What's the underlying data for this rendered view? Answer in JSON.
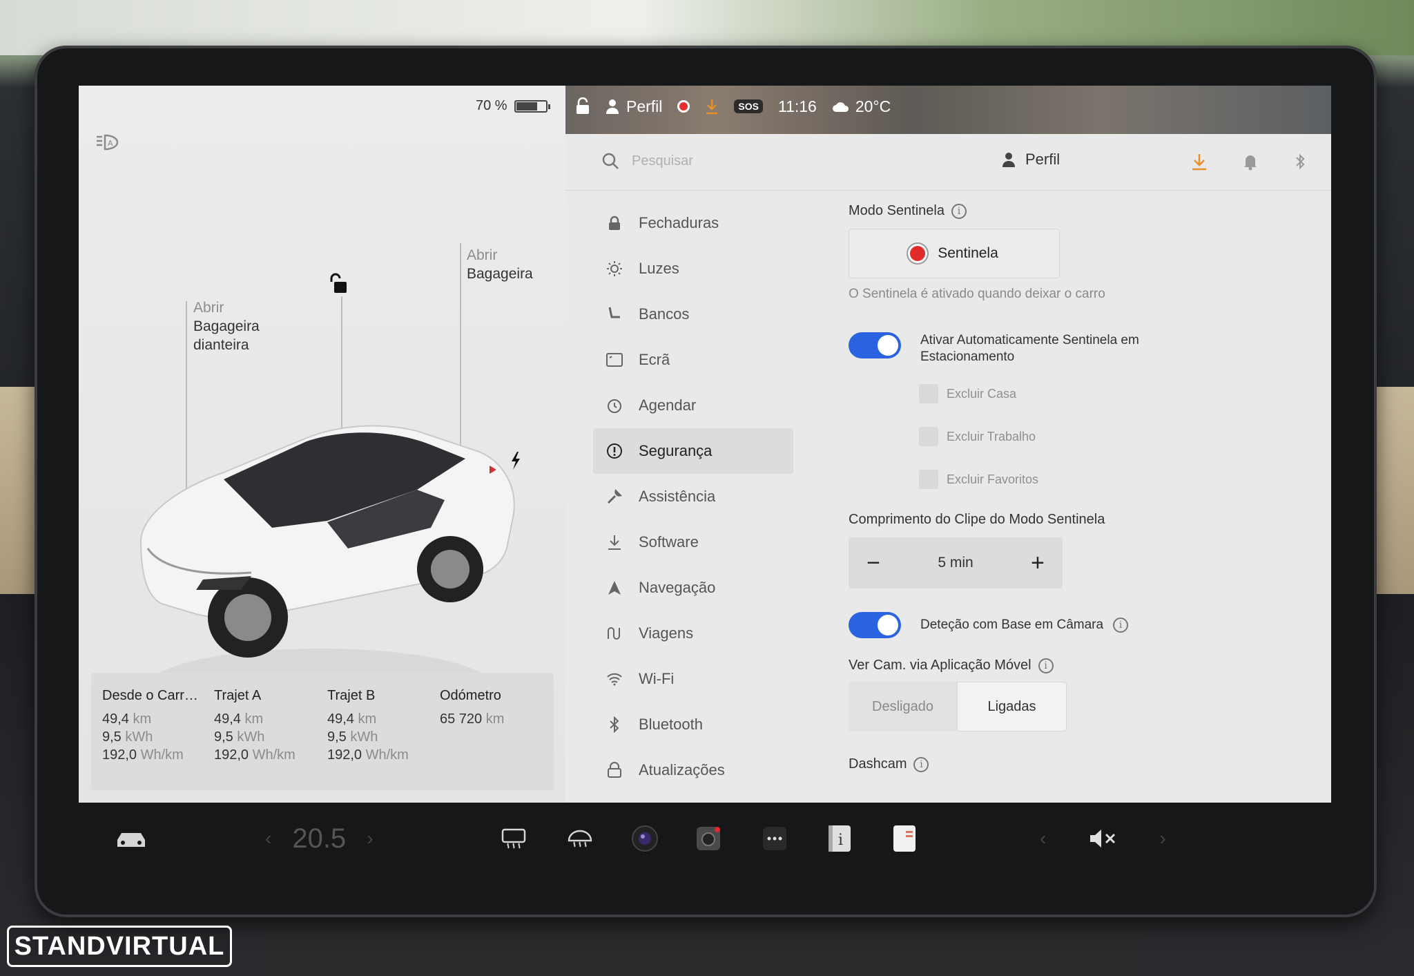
{
  "car_panel": {
    "battery_percent": "70 %",
    "battery_level": 0.7,
    "front_trunk": {
      "line1": "Abrir",
      "line2": "Bagageira",
      "line3": "dianteira"
    },
    "rear_trunk": {
      "line1": "Abrir",
      "line2": "Bagageira"
    },
    "trips": [
      {
        "header": "Desde o Carr…",
        "distance": "49,4",
        "distance_unit": " km",
        "energy": "9,5",
        "energy_unit": " kWh",
        "consumption": "192,0",
        "consumption_unit": " Wh/km"
      },
      {
        "header": "Trajet A",
        "distance": "49,4",
        "distance_unit": " km",
        "energy": "9,5",
        "energy_unit": " kWh",
        "consumption": "192,0",
        "consumption_unit": " Wh/km"
      },
      {
        "header": "Trajet B",
        "distance": "49,4",
        "distance_unit": " km",
        "energy": "9,5",
        "energy_unit": " kWh",
        "consumption": "192,0",
        "consumption_unit": " Wh/km"
      }
    ],
    "odometer": {
      "header": "Odómetro",
      "value": "65 720",
      "unit": " km"
    }
  },
  "status_bar": {
    "profile": "Perfil",
    "sos": "SOS",
    "time": "11:16",
    "weather": "20°C"
  },
  "topbar": {
    "search_placeholder": "Pesquisar",
    "profile_label": "Perfil"
  },
  "menu": [
    {
      "label": "Fechaduras",
      "icon": "lock-icon"
    },
    {
      "label": "Luzes",
      "icon": "sun-icon"
    },
    {
      "label": "Bancos",
      "icon": "seat-icon"
    },
    {
      "label": "Ecrã",
      "icon": "display-icon"
    },
    {
      "label": "Agendar",
      "icon": "clock-icon"
    },
    {
      "label": "Segurança",
      "icon": "alert-circle-icon",
      "active": true
    },
    {
      "label": "Assistência",
      "icon": "wrench-icon"
    },
    {
      "label": "Software",
      "icon": "download-icon"
    },
    {
      "label": "Navegação",
      "icon": "navigation-icon"
    },
    {
      "label": "Viagens",
      "icon": "trips-icon"
    },
    {
      "label": "Wi-Fi",
      "icon": "wifi-icon"
    },
    {
      "label": "Bluetooth",
      "icon": "bluetooth-icon"
    },
    {
      "label": "Atualizações",
      "icon": "updates-icon"
    }
  ],
  "security": {
    "sentry_title": "Modo Sentinela",
    "sentry_button": "Sentinela",
    "sentry_hint": "O Sentinela é ativado quando deixar o carro",
    "auto_sentry_label": "Ativar Automaticamente Sentinela em Estacionamento",
    "auto_sentry_on": true,
    "exclusions": [
      "Excluir Casa",
      "Excluir Trabalho",
      "Excluir Favoritos"
    ],
    "clip_length_title": "Comprimento do Clipe do Modo Sentinela",
    "clip_length_value": "5 min",
    "camera_detection_label": "Deteção com Base em Câmara",
    "camera_detection_on": true,
    "app_view_title": "Ver Cam. via Aplicação Móvel",
    "app_view_off": "Desligado",
    "app_view_on": "Ligadas",
    "dashcam_title": "Dashcam"
  },
  "dock": {
    "temperature": "20.5"
  },
  "watermark": "STANDVIRTUAL",
  "colors": {
    "toggle_blue": "#2a63e0",
    "record_red": "#e12a2a",
    "download_orange": "#e8902a"
  }
}
